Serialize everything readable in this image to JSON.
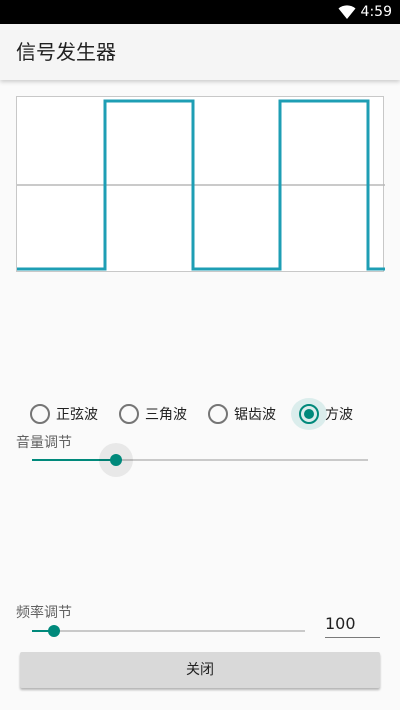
{
  "status_bar": {
    "time": "4:59",
    "icons": [
      "wifi-icon"
    ]
  },
  "app_bar": {
    "title": "信号发生器"
  },
  "scope": {
    "waveform": "square",
    "colors": {
      "wave": "#1e9eb4",
      "axis": "#b8b8b8",
      "border": "#c8c8c8"
    }
  },
  "wave_options": {
    "items": [
      {
        "label": "正弦波",
        "checked": false
      },
      {
        "label": "三角波",
        "checked": false
      },
      {
        "label": "锯齿波",
        "checked": false
      },
      {
        "label": "方波",
        "checked": true
      }
    ]
  },
  "volume": {
    "label": "音量调节",
    "fraction": 0.25
  },
  "frequency": {
    "label": "频率调节",
    "fraction": 0.08,
    "value": "100"
  },
  "close_button": {
    "label": "关闭"
  },
  "colors": {
    "accent": "#00897b"
  }
}
